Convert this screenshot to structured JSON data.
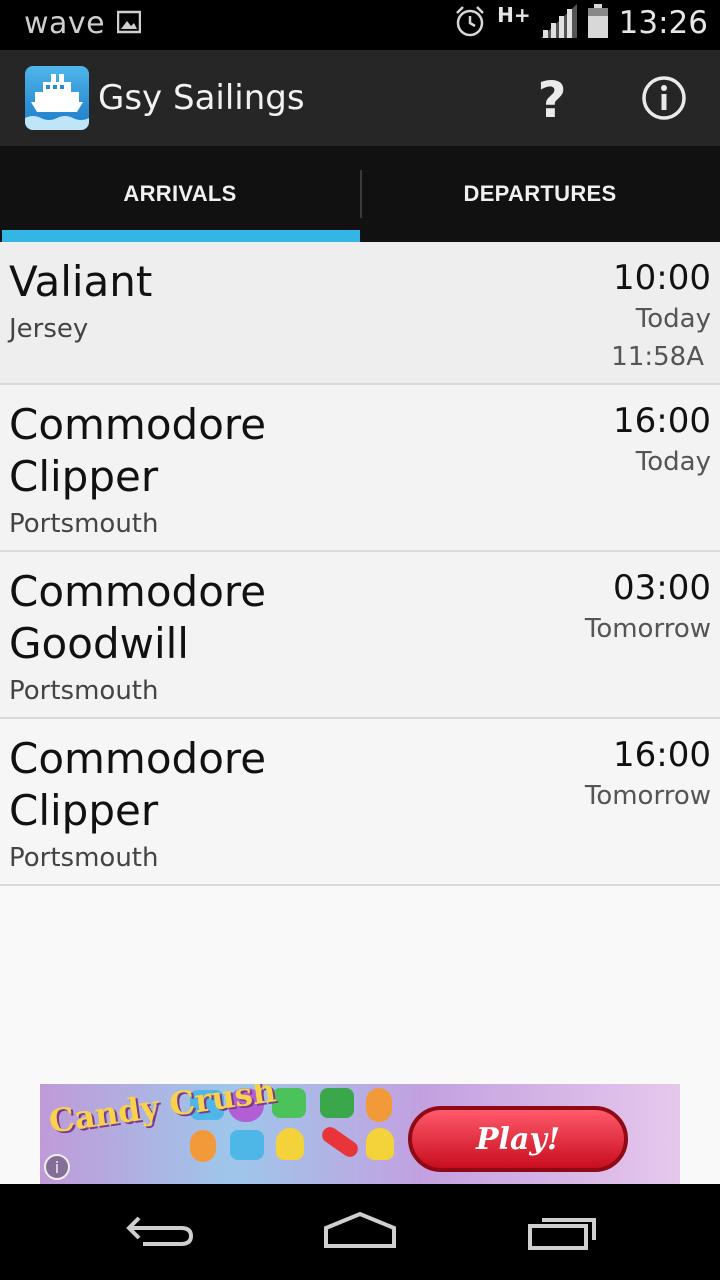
{
  "status_bar": {
    "carrier": "wave",
    "network": "H+",
    "time": "13:26",
    "icons": [
      "image-icon",
      "alarm-icon",
      "signal-icon",
      "battery-icon"
    ]
  },
  "app_bar": {
    "title": "Gsy Sailings",
    "help_icon": "question-mark-icon",
    "info_icon": "info-icon",
    "app_icon": "ferry-icon"
  },
  "tabs": [
    {
      "label": "ARRIVALS",
      "selected": true
    },
    {
      "label": "DEPARTURES",
      "selected": false
    }
  ],
  "sailings": [
    {
      "vessel": "Valiant",
      "port": "Jersey",
      "time": "10:00",
      "day": "Today",
      "actual": "11:58A"
    },
    {
      "vessel": "Commodore\nClipper",
      "vessel_lines": [
        "Commodore",
        "Clipper"
      ],
      "port": "Portsmouth",
      "time": "16:00",
      "day": "Today",
      "actual": ""
    },
    {
      "vessel": "Commodore\nGoodwill",
      "vessel_lines": [
        "Commodore",
        "Goodwill"
      ],
      "port": "Portsmouth",
      "time": "03:00",
      "day": "Tomorrow",
      "actual": ""
    },
    {
      "vessel": "Commodore\nClipper",
      "vessel_lines": [
        "Commodore",
        "Clipper"
      ],
      "port": "Portsmouth",
      "time": "16:00",
      "day": "Tomorrow",
      "actual": ""
    }
  ],
  "ad": {
    "brand": "Candy Crush",
    "cta": "Play!"
  },
  "nav_bar": {
    "buttons": [
      "back-icon",
      "home-icon",
      "recent-apps-icon"
    ]
  },
  "colors": {
    "accent": "#33b5e5",
    "action_bar": "#262626",
    "tab_bar": "#111111",
    "list_bg": "#f9f9f9"
  }
}
